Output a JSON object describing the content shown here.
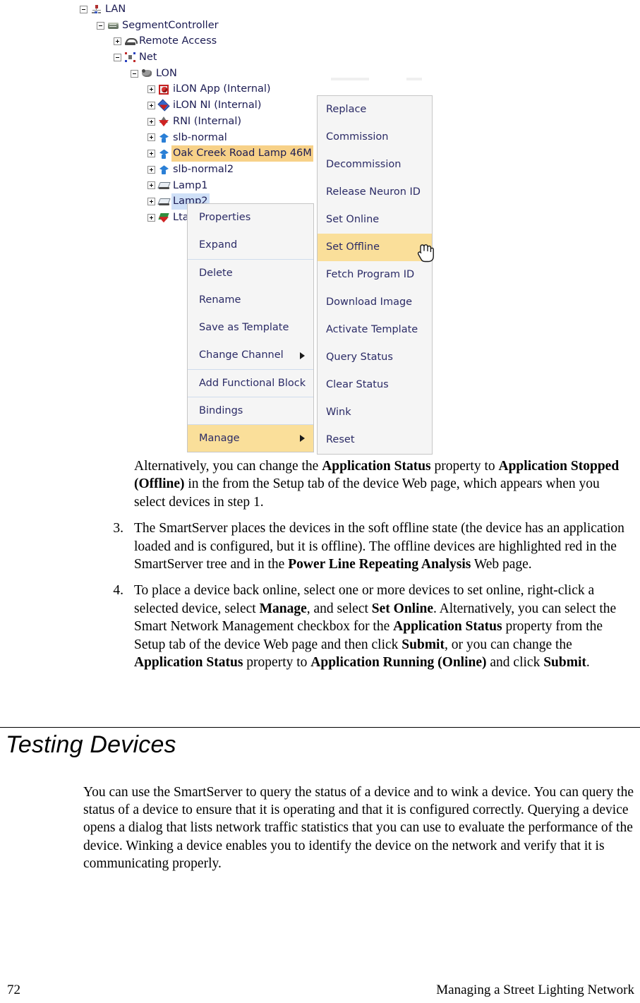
{
  "figure": {
    "tree": {
      "nodes": [
        {
          "label": "LAN",
          "icon": "lan-icon",
          "toggle": "minus",
          "indent": 0,
          "highlight": "none"
        },
        {
          "label": "SegmentController",
          "icon": "segment-controller-icon",
          "toggle": "minus",
          "indent": 1,
          "highlight": "none"
        },
        {
          "label": "Remote Access",
          "icon": "phone-icon",
          "toggle": "plus",
          "indent": 2,
          "highlight": "none"
        },
        {
          "label": "Net",
          "icon": "network-icon",
          "toggle": "minus",
          "indent": 2,
          "highlight": "none"
        },
        {
          "label": "LON",
          "icon": "lon-icon",
          "toggle": "minus",
          "indent": 3,
          "highlight": "none"
        },
        {
          "label": "iLON App (Internal)",
          "icon": "ilon-app-icon",
          "toggle": "plus",
          "indent": 4,
          "highlight": "none"
        },
        {
          "label": "iLON NI (Internal)",
          "icon": "ilon-ni-icon",
          "toggle": "plus",
          "indent": 4,
          "highlight": "none"
        },
        {
          "label": "RNI (Internal)",
          "icon": "rni-icon",
          "toggle": "plus",
          "indent": 4,
          "highlight": "none"
        },
        {
          "label": "slb-normal",
          "icon": "device-icon",
          "toggle": "plus",
          "indent": 4,
          "highlight": "none"
        },
        {
          "label": "Oak Creek Road Lamp 46M",
          "icon": "device-icon",
          "toggle": "plus",
          "indent": 4,
          "highlight": "orange"
        },
        {
          "label": "slb-normal2",
          "icon": "device-icon",
          "toggle": "plus",
          "indent": 4,
          "highlight": "none"
        },
        {
          "label": "Lamp1",
          "icon": "lamp-icon",
          "toggle": "plus",
          "indent": 4,
          "highlight": "none"
        },
        {
          "label": "Lamp2",
          "icon": "lamp-icon",
          "toggle": "plus",
          "indent": 4,
          "highlight": "blue"
        },
        {
          "label": "Ltal",
          "icon": "ltal-icon",
          "toggle": "plus",
          "indent": 4,
          "highlight": "none"
        }
      ]
    },
    "context_menu": {
      "name": "device-context-menu",
      "items": [
        {
          "label": "Properties",
          "separator_above": false,
          "submenu": false,
          "highlight": false
        },
        {
          "label": "Expand",
          "separator_above": false,
          "submenu": false,
          "highlight": false
        },
        {
          "label": "Delete",
          "separator_above": true,
          "submenu": false,
          "highlight": false
        },
        {
          "label": "Rename",
          "separator_above": false,
          "submenu": false,
          "highlight": false
        },
        {
          "label": "Save as Template",
          "separator_above": false,
          "submenu": false,
          "highlight": false
        },
        {
          "label": "Change Channel",
          "separator_above": false,
          "submenu": true,
          "highlight": false
        },
        {
          "label": "Add Functional Block",
          "separator_above": true,
          "submenu": false,
          "highlight": false
        },
        {
          "label": "Bindings",
          "separator_above": true,
          "submenu": false,
          "highlight": false
        },
        {
          "label": "Manage",
          "separator_above": true,
          "submenu": true,
          "highlight": true
        }
      ]
    },
    "submenu": {
      "name": "manage-submenu",
      "items": [
        {
          "label": "Replace",
          "highlight": false
        },
        {
          "label": "Commission",
          "highlight": false
        },
        {
          "label": "Decommission",
          "highlight": false
        },
        {
          "label": "Release Neuron ID",
          "highlight": false
        },
        {
          "label": "Set Online",
          "highlight": false
        },
        {
          "label": "Set Offline",
          "highlight": true
        },
        {
          "label": "Fetch Program ID",
          "highlight": false
        },
        {
          "label": "Download Image",
          "highlight": false
        },
        {
          "label": "Activate Template",
          "highlight": false
        },
        {
          "label": "Query Status",
          "highlight": false
        },
        {
          "label": "Clear Status",
          "highlight": false
        },
        {
          "label": "Wink",
          "highlight": false
        },
        {
          "label": "Reset",
          "highlight": false
        }
      ]
    },
    "colors": {
      "menu_background": "#f5f5f5",
      "menu_border": "#c6c6c6",
      "menu_text": "#2b2b66",
      "highlight": "#fadf9a",
      "separator": "#cfdcec",
      "tree_select_orange": "#f7d188",
      "tree_select_blue": "#cfe0f7"
    }
  },
  "document": {
    "alt_paragraph": {
      "p1": "Alternatively, you can change the ",
      "b1": "Application Status",
      "p2": " property to ",
      "b2": "Application Stopped (Offline)",
      "p3": " in the from the Setup tab of the device Web page, which appears when you select devices in step 1."
    },
    "step3": {
      "number": "3.",
      "p1": "The SmartServer places the devices in the soft offline state (the device has an application loaded and is configured, but it is offline).  The offline devices are highlighted red in the SmartServer tree and in the ",
      "b1": "Power Line Repeating Analysis",
      "p2": " Web page."
    },
    "step4": {
      "number": "4.",
      "p1": "To place a device back online, select one or more devices to set online, right-click a selected device, select ",
      "b1": "Manage",
      "p2": ", and select ",
      "b2": "Set Online",
      "p3": ".  Alternatively, you can select the Smart Network Management checkbox for the ",
      "b3": "Application Status",
      "p4": " property from the Setup tab of the device Web page and then click ",
      "b4": "Submit",
      "p5": ", or you can change the ",
      "b5": "Application Status",
      "p6": " property to ",
      "b6": "Application Running (Online)",
      "p7": " and click ",
      "b7": "Submit",
      "p8": "."
    },
    "section": {
      "heading": "Testing Devices",
      "paragraph": "You can use the SmartServer to query the status of a device and to wink a device.  You can query the status of a device to ensure that it is operating and that it is configured correctly.  Querying a device opens a dialog that lists network traffic statistics that you can use to evaluate the performance of the device.  Winking a device enables you to identify the device on the network and verify that it is communicating properly."
    },
    "footer": {
      "page_number": "72",
      "running_title": "Managing a Street Lighting Network"
    }
  }
}
